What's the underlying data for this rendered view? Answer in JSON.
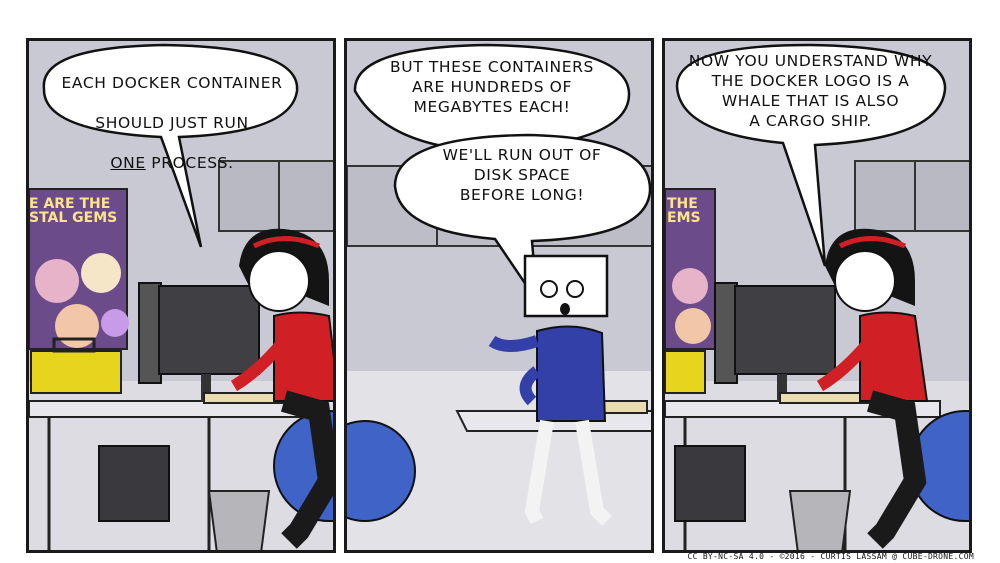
{
  "panels": [
    {
      "speech": {
        "line1": "EACH DOCKER CONTAINER",
        "line2": "SHOULD JUST RUN",
        "line3_emph": "ONE",
        "line3_rest": " PROCESS."
      },
      "poster": {
        "line1": "E ARE THE",
        "line2": "STAL GEMS"
      }
    },
    {
      "speech_a": "BUT THESE CONTAINERS\nARE HUNDREDS OF\nMEGABYTES EACH!",
      "speech_b": "WE'LL RUN OUT OF\nDISK SPACE\nBEFORE LONG!"
    },
    {
      "speech": "NOW YOU UNDERSTAND WHY\nTHE DOCKER LOGO IS A\nWHALE THAT IS ALSO\nA CARGO SHIP.",
      "poster": {
        "line1": "THE",
        "line2": "EMS"
      }
    }
  ],
  "credit": "CC BY-NC-SA 4.0 - ©2016 - CURTIS LASSAM @ CUBE-DRONE.COM",
  "colors": {
    "wall": "#c9c9d3",
    "floor": "#d9d9df",
    "desk": "#e4e4e8",
    "shirt_red": "#d11f26",
    "shirt_blue": "#3340a8",
    "ball_blue": "#3f63c6",
    "hair": "#141414",
    "toolbox": "#e6d51c"
  }
}
